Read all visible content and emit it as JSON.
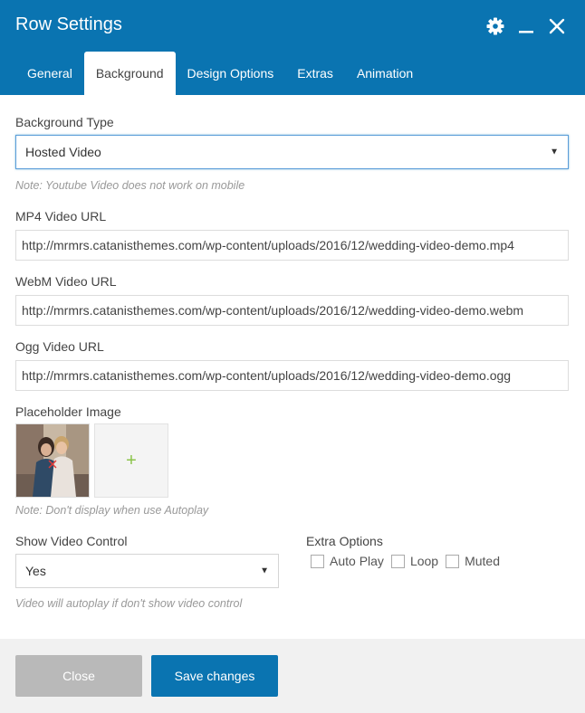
{
  "header": {
    "title": "Row Settings",
    "icons": [
      "gear-icon",
      "minimize-icon",
      "close-icon"
    ]
  },
  "tabs": [
    {
      "label": "General",
      "active": false
    },
    {
      "label": "Background",
      "active": true
    },
    {
      "label": "Design Options",
      "active": false
    },
    {
      "label": "Extras",
      "active": false
    },
    {
      "label": "Animation",
      "active": false
    }
  ],
  "form": {
    "background_type": {
      "label": "Background Type",
      "value": "Hosted Video",
      "note": "Note: Youtube Video does not work on mobile"
    },
    "mp4": {
      "label": "MP4 Video URL",
      "value": "http://mrmrs.catanisthemes.com/wp-content/uploads/2016/12/wedding-video-demo.mp4"
    },
    "webm": {
      "label": "WebM Video URL",
      "value": "http://mrmrs.catanisthemes.com/wp-content/uploads/2016/12/wedding-video-demo.webm"
    },
    "ogg": {
      "label": "Ogg Video URL",
      "value": "http://mrmrs.catanisthemes.com/wp-content/uploads/2016/12/wedding-video-demo.ogg"
    },
    "placeholder": {
      "label": "Placeholder Image",
      "add_symbol": "+",
      "note": "Note: Don't display when use Autoplay"
    },
    "video_control": {
      "label": "Show Video Control",
      "value": "Yes",
      "note": "Video will autoplay if don't show video control"
    },
    "extra_options": {
      "label": "Extra Options",
      "options": [
        {
          "label": "Auto Play",
          "checked": false
        },
        {
          "label": "Loop",
          "checked": false
        },
        {
          "label": "Muted",
          "checked": false
        }
      ]
    }
  },
  "footer": {
    "close_label": "Close",
    "save_label": "Save changes"
  },
  "colors": {
    "accent": "#0a74b1",
    "add_plus": "#8bc34a"
  }
}
